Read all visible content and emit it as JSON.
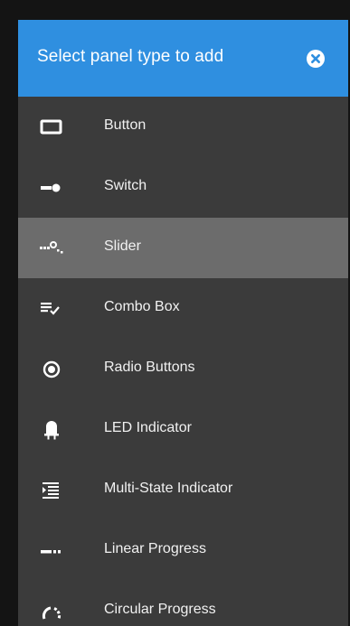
{
  "dialog": {
    "title": "Select panel type to add",
    "close_icon": "close-circle-icon",
    "header_color": "#2f8fe0",
    "background_color": "#3b3b3b",
    "selected_color": "#6c6c6c"
  },
  "panel_types": [
    {
      "label": "Button",
      "icon": "button-icon",
      "selected": false
    },
    {
      "label": "Switch",
      "icon": "switch-icon",
      "selected": false
    },
    {
      "label": "Slider",
      "icon": "slider-icon",
      "selected": true
    },
    {
      "label": "Combo Box",
      "icon": "combo-box-icon",
      "selected": false
    },
    {
      "label": "Radio Buttons",
      "icon": "radio-button-icon",
      "selected": false
    },
    {
      "label": "LED Indicator",
      "icon": "led-icon",
      "selected": false
    },
    {
      "label": "Multi-State Indicator",
      "icon": "multi-state-indicator-icon",
      "selected": false
    },
    {
      "label": "Linear Progress",
      "icon": "linear-progress-icon",
      "selected": false
    },
    {
      "label": "Circular Progress",
      "icon": "circular-progress-icon",
      "selected": false
    }
  ]
}
